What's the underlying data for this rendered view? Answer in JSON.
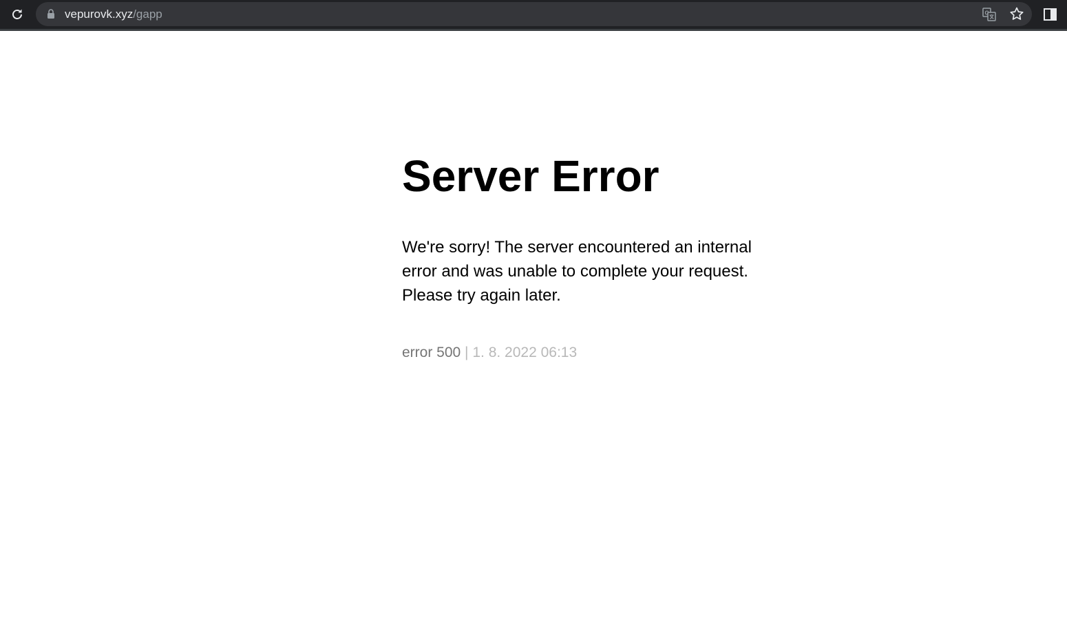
{
  "browser": {
    "url_host": "vepurovk.xyz",
    "url_path": "/gapp",
    "icons": {
      "reload": "reload-icon",
      "lock": "lock-icon",
      "translate": "translate-icon",
      "bookmark": "star-icon",
      "side_panel": "side-panel-icon"
    },
    "colors": {
      "toolbar": "#202124",
      "omnibox": "#35363a",
      "url_host": "#e8eaed",
      "url_path": "#9aa0a6"
    }
  },
  "page": {
    "title": "Server Error",
    "message": "We're sorry! The server encountered an internal error and was unable to complete your request. Please try again later.",
    "error_code": "error 500",
    "separator": " | ",
    "timestamp": "1. 8. 2022 06:13",
    "colors": {
      "error_code": "#757575",
      "timestamp": "#b8b8b8"
    }
  }
}
